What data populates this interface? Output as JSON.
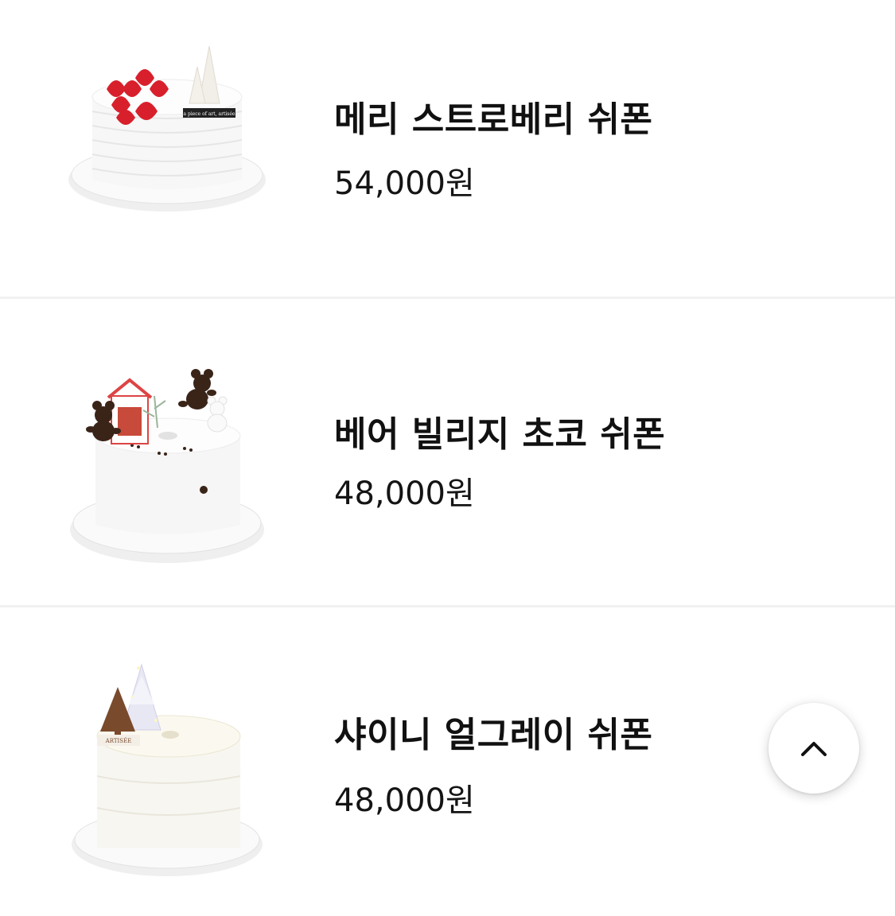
{
  "products": [
    {
      "name": "메리 스트로베리 쉬폰",
      "price": "54,000원",
      "image_icon": "strawberry-chiffon-cake",
      "topper_text": "a piece of art, artisée"
    },
    {
      "name": "베어 빌리지 초코 쉬폰",
      "price": "48,000원",
      "image_icon": "bear-village-chiffon-cake"
    },
    {
      "name": "샤이니 얼그레이 쉬폰",
      "price": "48,000원",
      "image_icon": "earl-grey-chiffon-cake",
      "topper_text": "ARTISÉE"
    }
  ],
  "scroll_top_button": {
    "icon": "chevron-up-icon"
  },
  "colors": {
    "background": "#ffffff",
    "text": "#111111",
    "divider": "#f1f1f1",
    "strawberry": "#d8202c",
    "chocolate": "#3a2418"
  }
}
